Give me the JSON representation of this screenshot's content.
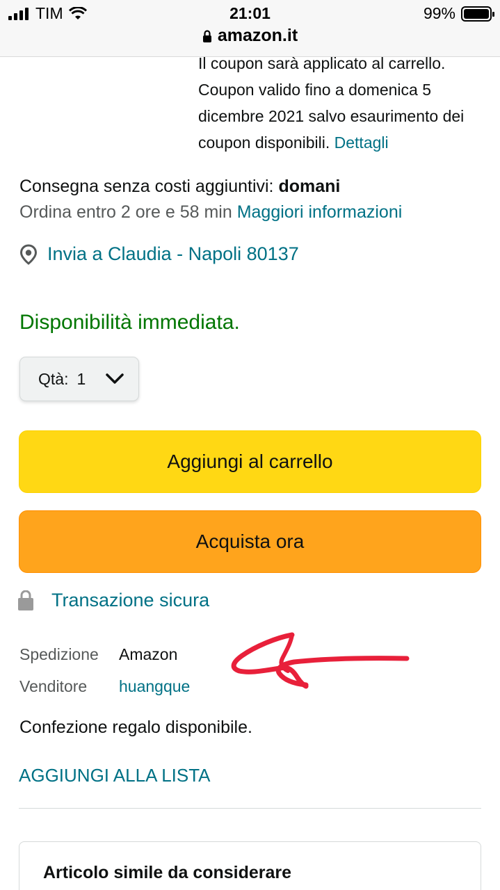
{
  "status_bar": {
    "carrier": "TIM",
    "time": "21:01",
    "battery": "99%",
    "battery_level": 0.99
  },
  "url_bar": {
    "domain": "amazon.it"
  },
  "coupon": {
    "text": "Il coupon sarà applicato al carrello. Coupon valido fino a domenica 5 dicembre 2021 salvo esaurimento dei coupon disponibili.",
    "details_link": "Dettagli"
  },
  "delivery": {
    "label": "Consegna senza costi aggiuntivi:",
    "day": "domani",
    "order_within": "Ordina entro 2 ore e 58 min",
    "more_info": "Maggiori informazioni"
  },
  "address": {
    "text": "Invia a Claudia - Napoli 80137",
    "icon": "location-pin-icon"
  },
  "availability": "Disponibilità immediata.",
  "quantity": {
    "label": "Qtà:",
    "value": "1"
  },
  "buttons": {
    "add_to_cart": "Aggiungi al carrello",
    "buy_now": "Acquista ora"
  },
  "secure": {
    "text": "Transazione sicura",
    "icon": "lock-icon"
  },
  "seller_info": {
    "shipping_label": "Spedizione",
    "shipping_value": "Amazon",
    "seller_label": "Venditore",
    "seller_value": "huangque"
  },
  "gift": "Confezione regalo disponibile.",
  "add_to_list": "AGGIUNGI ALLA LISTA",
  "similar": {
    "title": "Articolo simile da considerare"
  },
  "colors": {
    "link": "#007185",
    "in_stock": "#007600",
    "cart_button": "#ffd814",
    "buy_button": "#ffa41c",
    "annotation": "#e8203a"
  }
}
